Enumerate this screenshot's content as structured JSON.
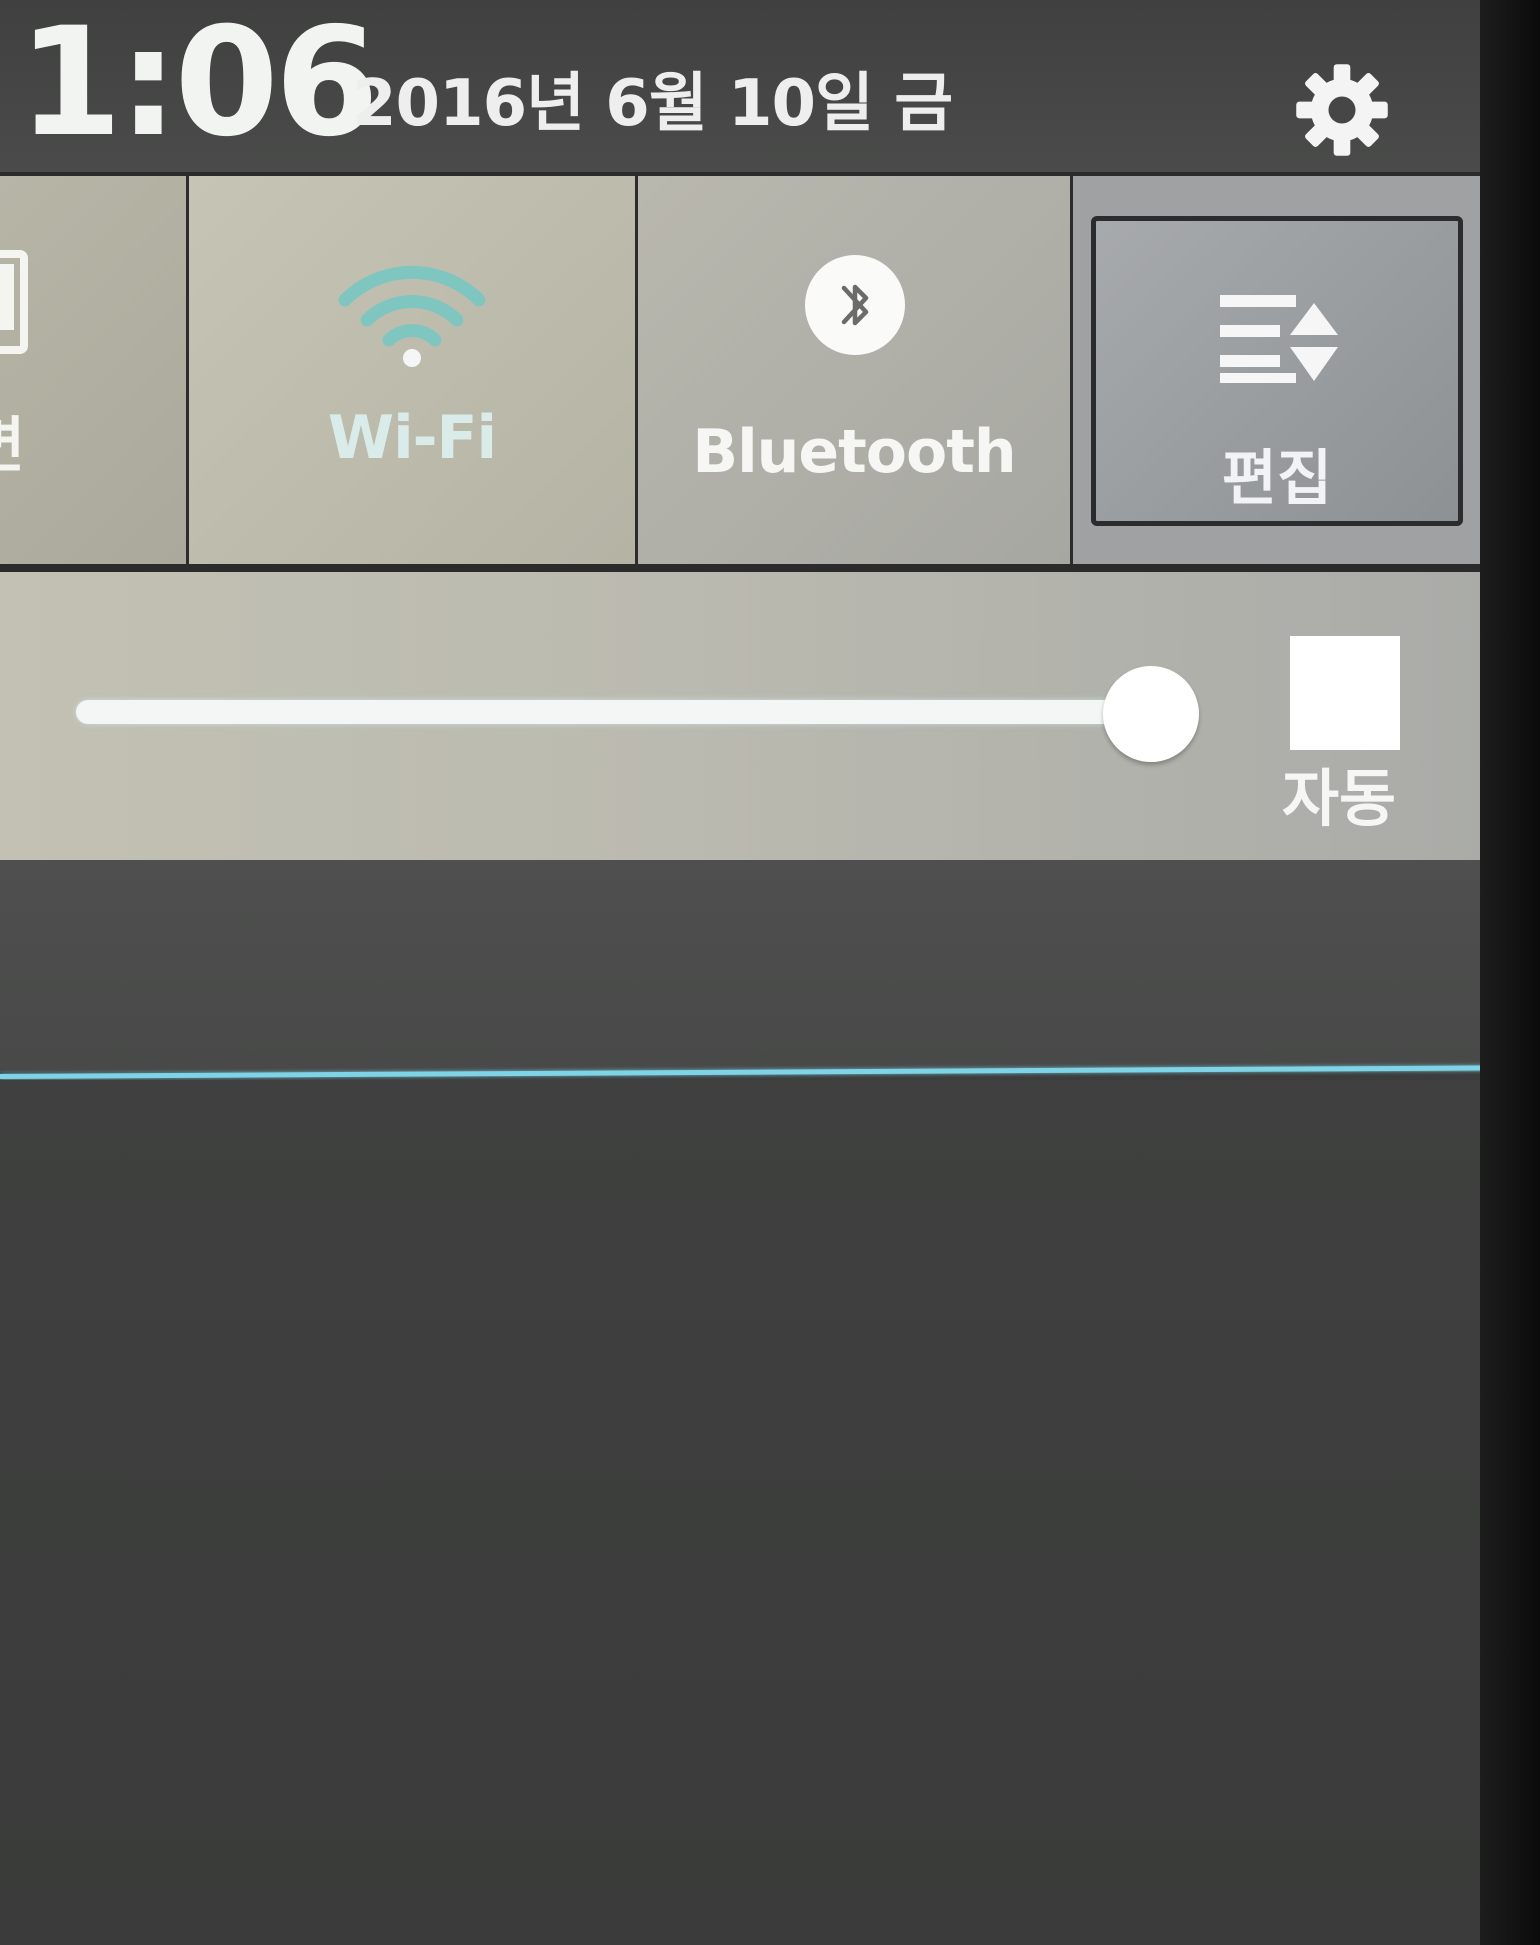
{
  "status": {
    "time": "1:06",
    "date": "2016년 6월 10일 금",
    "settings_icon": "gear-icon"
  },
  "quick_settings": {
    "tiles": [
      {
        "id": "screen",
        "label": "면",
        "icon": "screen-icon",
        "state": "partially-visible"
      },
      {
        "id": "wifi",
        "label": "Wi-Fi",
        "icon": "wifi-icon",
        "state": "on",
        "accent": "#7fc6c0"
      },
      {
        "id": "bluetooth",
        "label": "Bluetooth",
        "icon": "bluetooth-icon",
        "state": "off"
      },
      {
        "id": "edit",
        "label": "편집",
        "icon": "edit-sort-icon",
        "state": "selected"
      }
    ]
  },
  "brightness": {
    "level": 0.96,
    "auto_label": "자동",
    "auto_checked": false
  },
  "colors": {
    "accent_divider": "#7fd3e6",
    "header_bg": "#444544",
    "tile_bg": "#b8b7a8"
  }
}
